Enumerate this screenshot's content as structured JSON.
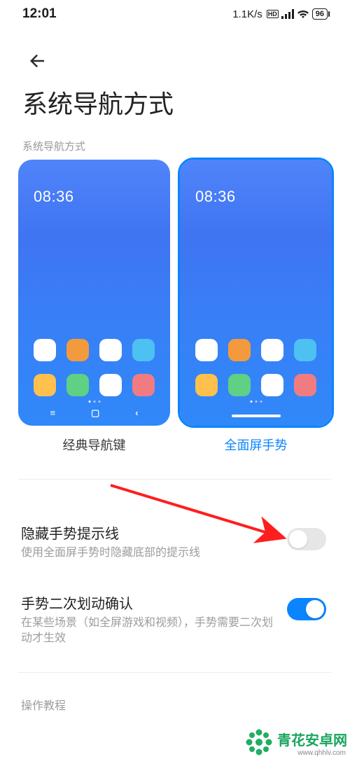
{
  "status": {
    "time": "12:01",
    "speed": "1.1K/s",
    "battery": "96"
  },
  "header": {
    "title": "系统导航方式",
    "section_label": "系统导航方式"
  },
  "nav_options": {
    "preview_time": "08:36",
    "classic": {
      "label": "经典导航键"
    },
    "gesture": {
      "label": "全面屏手势"
    },
    "icon_colors": {
      "row1": [
        "#ffffff",
        "#f39a3d",
        "#ffffff",
        "#4dc1f2"
      ],
      "row2": [
        "#ffc04d",
        "#5fd084",
        "#ffffff",
        "#f07c82"
      ]
    }
  },
  "settings": {
    "hide_hint": {
      "title": "隐藏手势提示线",
      "desc": "使用全面屏手势时隐藏底部的提示线",
      "on": false
    },
    "double_swipe": {
      "title": "手势二次划动确认",
      "desc": "在某些场景（如全屏游戏和视频），手势需要二次划动才生效",
      "on": true
    }
  },
  "bottom_link": "操作教程",
  "watermark": {
    "text": "青花安卓网",
    "url": "www.qhhlv.com"
  }
}
